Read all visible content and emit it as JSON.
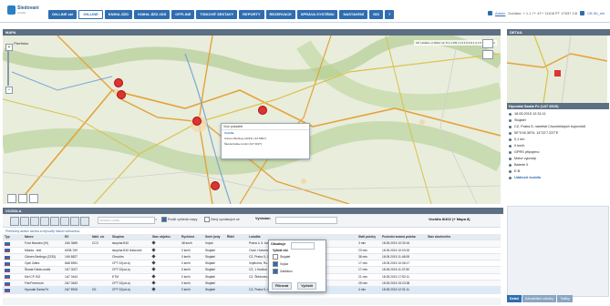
{
  "app": {
    "logo_title": "Sledovani",
    "logo_sub": "vozidel"
  },
  "nav": [
    "ON-LINE stě",
    "ON-LINE",
    "KNIHA JÍZD",
    "KNIHA JÍZD 2DS",
    "OFFLINE",
    "TISKOVÉ SESTAVY",
    "REPORTY",
    "REZERVACE",
    "SPRÁVA SYSTÉMU",
    "NASTAVENÍ",
    "GIS",
    "?"
  ],
  "nav_active_index": 1,
  "user": {
    "name": "Admin",
    "info": "Dohlání: + 1.1 7+ 4T+ 11108 PT 1T837 1/8",
    "lang": "CB  Sb_shl"
  },
  "map": {
    "header": "MAPA",
    "place_label": "Plzeňsko",
    "coord_text": "CZ, Hodkov, 2 (Rxkv 12, 8.1 1 PM )  1 0 4 9 4 8 1 3 2 8 9 8 1 5 3 2",
    "popup": {
      "title": "Více pokazbě",
      "rows": [
        "Vozidla",
        "Citroen Berlingo (2233)  ( 6X 8827)",
        "Škoda Fabia combi (147 3027)"
      ],
      "selected_index": 0
    }
  },
  "detail": {
    "header": "DETAIL",
    "title": "Hyundai Santa Fe (1AT 8915)",
    "rows": [
      {
        "icon": "clock-icon",
        "text": "18.05.2015 12:31:11"
      },
      {
        "icon": "status-icon",
        "text": "Stojatel"
      },
      {
        "icon": "location-icon",
        "text": "CZ, Praha 5, náměstí Chuchelských bojovníků"
      },
      {
        "icon": "gps-icon",
        "text": "50°0'40.35\"N, 14°22'7.237\"E"
      },
      {
        "icon": "distance-icon",
        "text": "0,1 km"
      },
      {
        "icon": "speed-icon",
        "text": "0 km/h"
      },
      {
        "icon": "gps-signal-icon",
        "text": "GPRS připojeno"
      },
      {
        "icon": "engine-icon",
        "text": "Motor vypnutý"
      },
      {
        "icon": "battery-icon",
        "text": "Baterie 0"
      },
      {
        "icon": "note-icon",
        "text": "E.B."
      },
      {
        "icon": "warning-icon",
        "text": "Události vozidla",
        "bold": true
      }
    ],
    "tabs": [
      "Detail",
      "Uživatelské záložky",
      "Trafiky"
    ]
  },
  "vehicles": {
    "header": "VOZIDLA",
    "search_placeholder": "Vyhledat vozidla",
    "opt1": "Rodič vyhledá mapy",
    "opt2": "Zdroj vyvolaných se",
    "find_label": "Vyhledat:",
    "count": "Vozidla 8/402 (+ Mapa 8)",
    "filter_info": "Přehledný aktivní služba a nejnověji historii zobrazeno",
    "columns": [
      "Typ",
      "Název",
      "RZ",
      "Nákl. víc",
      "Skupina",
      "Stav objektu",
      "Rychlost",
      "Směr jízdy",
      "Řidič",
      "Lokalita",
      "Stáří polohy",
      "Poslední známá poloha",
      "Stav zbočeného"
    ],
    "rows": [
      [
        "",
        "Ford Mondeo (IH)",
        "2A0 3669",
        "CC3",
        "skupina B10",
        "",
        "48 km/h",
        "Vojúci",
        "",
        "Praha 4, 5. květnia",
        "3 min",
        "18.05.2015 10:30:16",
        ""
      ],
      [
        "",
        "Mazda - test",
        "6208-769",
        "",
        "skupina B10 testovaní",
        "",
        "0 km/h",
        "Stojatel",
        "",
        "Ovail, Hodstice",
        "23 min",
        "18.05.2015 10:03:32",
        ""
      ],
      [
        "",
        "Citroen Berlingo (2233)",
        "1K6 8827",
        "",
        "Chrudim",
        "",
        "0 km/h",
        "Stojatel",
        "",
        "CZ, Praha 5, Jinonice",
        "38 min",
        "18.05.2015 11:48:08",
        ""
      ],
      [
        "",
        "Opel Zafira",
        "8A8 8951",
        "",
        "CPT 02(od.a)",
        "",
        "0 km/h",
        "Stojatel",
        "",
        "Vojtěchov, Ro-Bonanich",
        "17 min",
        "18.05.2015 10:06:17",
        ""
      ],
      [
        "",
        "Škoda Fabia combi",
        "1K7 3027",
        "",
        "CPT 02(od.a)",
        "",
        "0 km/h",
        "Stojatel",
        "",
        "CZ, 1 Hodkov 29, Chrudim, Šlikoupové",
        "17 min",
        "18.05.2015 11:37:50",
        ""
      ],
      [
        "",
        "Kiel CP 002",
        "1A7 0444",
        "",
        "ETM",
        "",
        "0 km/h",
        "Stojatel",
        "",
        "CZ, Štědrotec, Ptšáluphcev",
        "21 min",
        "18.05.2015 17:52:11",
        ""
      ],
      [
        "",
        "Fiat Freemont",
        "2A7 0643",
        "",
        "CPT 02(od.a)",
        "",
        "0 km/h",
        "Stojatel",
        "",
        "",
        "25 min",
        "18.05.2015 15:23:38",
        ""
      ],
      [
        "",
        "Hyundai Santa Fe",
        "2A7 8915",
        "0G",
        "CPT 02(od.a)",
        "",
        "0 km/h",
        "Stojatel",
        "",
        "CZ, Praha 5, náměstí Chuchelských bojovníků",
        "4 min",
        "18.05.2015 12:31:11",
        ""
      ]
    ],
    "selected_row": 7,
    "filter_popup": {
      "label": "Obsahuje",
      "header": "Vybrat vše",
      "items": [
        {
          "text": "Stojatel",
          "checked": false
        },
        {
          "text": "Vojúci",
          "checked": true
        },
        {
          "text": "Zablokov",
          "checked": true
        }
      ],
      "ok": "Filtrovat",
      "clear": "Vyčistit"
    }
  },
  "colors": {
    "nav": "#2f6db0",
    "header": "#5c6f83",
    "pin": "#d33333"
  }
}
